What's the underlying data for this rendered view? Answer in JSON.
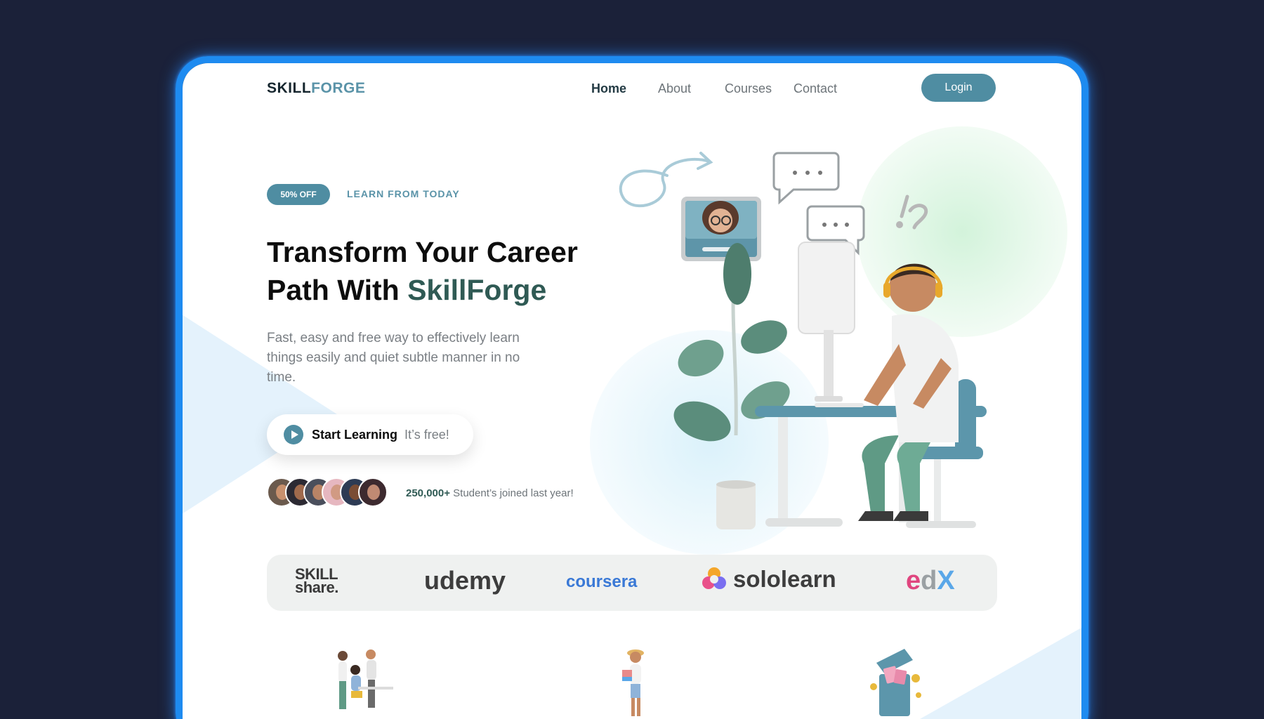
{
  "logo": {
    "part1": "SKILL",
    "part2": "FORGE"
  },
  "nav": {
    "home": "Home",
    "about": "About",
    "courses": "Courses",
    "contact": "Contact",
    "login": "Login"
  },
  "hero": {
    "badge": "50% OFF",
    "eyebrow": "LEARN FROM TODAY",
    "headline_line1": "Transform Your Career",
    "headline_line2_prefix": "Path With ",
    "headline_accent": "SkillForge",
    "description": "Fast, easy and free way to effectively learn things easily and quiet subtle manner in no time.",
    "cta_main": "Start Learning",
    "cta_sub": "It’s free!",
    "stat_value": "250,000+",
    "stat_text": " Student’s joined last year!"
  },
  "partners": {
    "skillshare_line1": "SKILL",
    "skillshare_line2": "share.",
    "udemy": "udemy",
    "coursera": "coursera",
    "sololearn": "sololearn",
    "edx_e": "e",
    "edx_d": "d",
    "edx_x": "X"
  },
  "colors": {
    "accent": "#4f8da2",
    "accent_dark": "#2f5a54",
    "frame": "#1e8bf0",
    "background": "#1b2139"
  },
  "icons": [
    "play-icon",
    "chat-bubble-icon",
    "swirl-arrow-icon"
  ]
}
